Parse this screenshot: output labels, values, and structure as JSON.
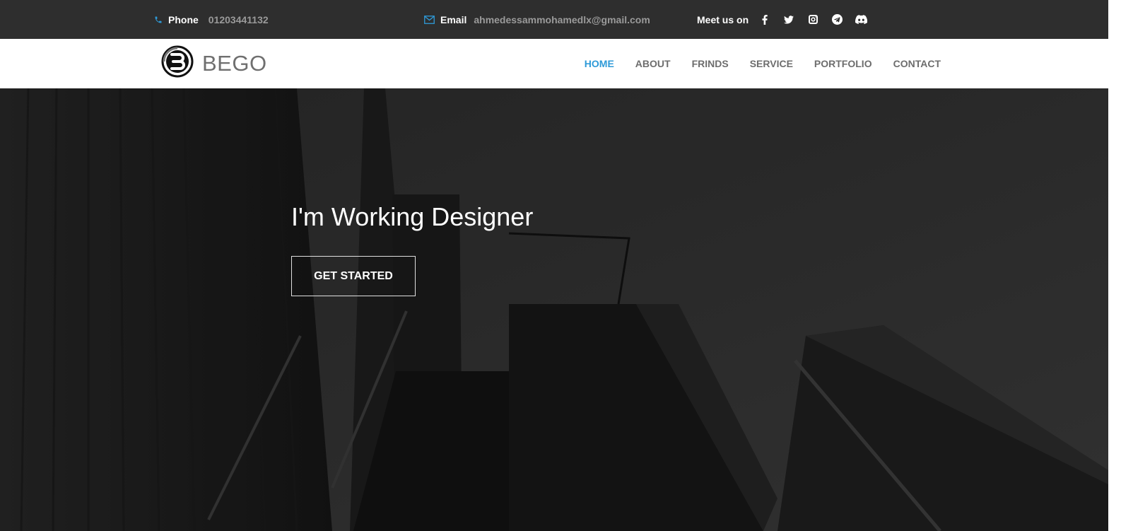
{
  "topbar": {
    "phone": {
      "label": "Phone",
      "value": "01203441132",
      "icon": "phone-icon"
    },
    "email": {
      "label": "Email",
      "value": "ahmedessammohamedlx@gmail.com",
      "icon": "envelope-icon"
    },
    "social": {
      "label": "Meet us on",
      "icons": [
        "facebook-icon",
        "twitter-icon",
        "instagram-icon",
        "telegram-icon",
        "discord-icon"
      ]
    }
  },
  "navbar": {
    "brand": "BEGO",
    "logo_icon": "bego-logo-icon",
    "items": [
      {
        "label": "HOME",
        "active": true
      },
      {
        "label": "ABOUT",
        "active": false
      },
      {
        "label": "FRINDS",
        "active": false
      },
      {
        "label": "SERVICE",
        "active": false
      },
      {
        "label": "PORTFOLIO",
        "active": false
      },
      {
        "label": "CONTACT",
        "active": false
      }
    ]
  },
  "hero": {
    "heading": "I'm Working Designer",
    "cta_label": "GET STARTED"
  },
  "colors": {
    "accent": "#2e9ad8",
    "topbar_bg": "#2e2e2e",
    "navbar_bg": "#ffffff",
    "nav_text": "#6d6d6d"
  }
}
